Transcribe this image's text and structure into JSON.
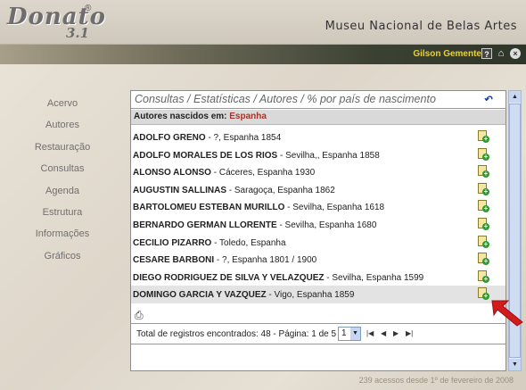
{
  "header": {
    "logo": "Donato",
    "logo_version": "3.1",
    "logo_mark": "®",
    "museum_name": "Museu Nacional de Belas Artes"
  },
  "userbar": {
    "username": "Gilson Gemente",
    "help_icon": "?",
    "home_icon": "home-icon",
    "close_icon": "close-icon"
  },
  "sidebar": {
    "items": [
      {
        "label": "Acervo"
      },
      {
        "label": "Autores"
      },
      {
        "label": "Restauração"
      },
      {
        "label": "Consultas"
      },
      {
        "label": "Agenda"
      },
      {
        "label": "Estrutura"
      },
      {
        "label": "Informações"
      },
      {
        "label": "Gráficos"
      }
    ]
  },
  "panel": {
    "title": "Consultas / Estatísticas / Autores / % por país de nascimento",
    "subheader_label": "Autores nascidos em:",
    "subheader_country": "Espanha",
    "rows": [
      {
        "name": "ADOLFO GRENO",
        "detail": " - ?, Espanha 1854"
      },
      {
        "name": "ADOLFO MORALES DE LOS RIOS",
        "detail": " - Sevilha,, Espanha 1858"
      },
      {
        "name": "ALONSO ALONSO",
        "detail": " - Cáceres, Espanha 1930"
      },
      {
        "name": "AUGUSTIN SALLINAS",
        "detail": " - Saragoça, Espanha 1862"
      },
      {
        "name": "BARTOLOMEU ESTEBAN MURILLO",
        "detail": " - Sevilha, Espanha 1618"
      },
      {
        "name": "BERNARDO GERMAN LLORENTE",
        "detail": " - Sevilha, Espanha 1680"
      },
      {
        "name": "CECILIO PIZARRO",
        "detail": " - Toledo, Espanha"
      },
      {
        "name": "CESARE BARBONI",
        "detail": " - ?, Espanha 1801 / 1900"
      },
      {
        "name": "DIEGO RODRIGUEZ DE SILVA Y VELAZQUEZ",
        "detail": " - Sevilha, Espanha 1599"
      },
      {
        "name": "DOMINGO GARCIA Y VAZQUEZ",
        "detail": " - Vigo, Espanha 1859"
      }
    ],
    "selected_row": 9,
    "pagination": {
      "text": "Total de registros encontrados: 48 - Página: 1 de 5",
      "page_value": "1"
    }
  },
  "footer": {
    "text": "239 acessos desde 1º de fevereiro de 2008"
  },
  "colors": {
    "country": "#a0362b",
    "username": "#e8d23a",
    "arrow": "#d01c1c"
  }
}
